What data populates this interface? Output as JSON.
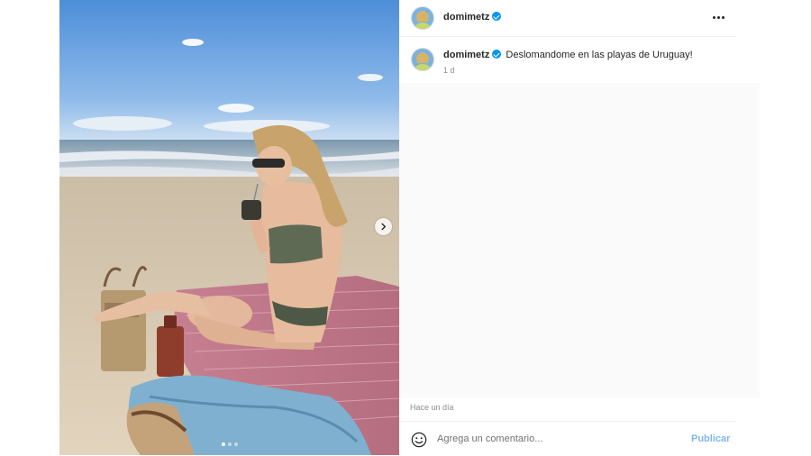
{
  "post": {
    "author": "domimetz",
    "verified": true,
    "caption": "Deslomandome en las playas de Uruguay!",
    "caption_age": "1 d",
    "time_ago": "Hace un día"
  },
  "media": {
    "description": "beach-photo",
    "carousel_count": 3,
    "carousel_active": 1
  },
  "comment": {
    "placeholder": "Agrega un comentario...",
    "publish_label": "Publicar"
  },
  "colors": {
    "accent": "#0095f6",
    "publish_disabled": "#7fb6f0",
    "secondary_text": "#8e8e8e"
  }
}
